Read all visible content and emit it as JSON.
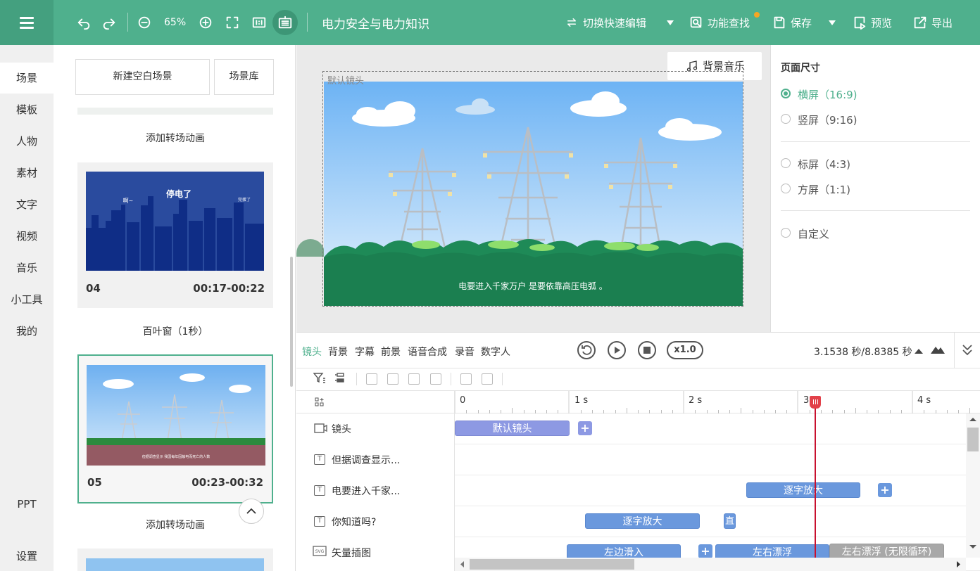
{
  "toolbar": {
    "zoom": "65%",
    "doc_title": "电力安全与电力知识",
    "switch_edit": "切换快速编辑",
    "find": "功能查找",
    "save": "保存",
    "preview": "预览",
    "export": "导出",
    "icons": [
      "menu-icon",
      "undo-icon",
      "redo-icon",
      "zoom-out-icon",
      "zoom-in-icon",
      "fullscreen-icon",
      "ratio-1-1-icon",
      "keyboard-icon",
      "swap-icon",
      "search-icon",
      "save-icon",
      "preview-icon",
      "export-icon"
    ]
  },
  "nav": {
    "items": [
      "场景",
      "模板",
      "人物",
      "素材",
      "文字",
      "视频",
      "音乐",
      "小工具",
      "我的"
    ],
    "ppt": "PPT",
    "settings": "设置"
  },
  "scenes": {
    "new_blank": "新建空白场景",
    "library": "场景库",
    "add_transition_1": "添加转场动画",
    "transition_label": "百叶窗（1秒）",
    "add_transition_2": "添加转场动画",
    "cards": [
      {
        "num": "04",
        "time": "00:17-00:22",
        "thumb_texts": [
          "停电了",
          "啊~",
          "完蛋了"
        ]
      },
      {
        "num": "05",
        "time": "00:23-00:32",
        "thumb_texts": [
          "但据调查显示 我国每年因触电而死亡的人数"
        ]
      }
    ]
  },
  "canvas": {
    "camera_label": "默认镜头",
    "bgm_button": "背景音乐",
    "subtitle": "电要进入千家万户 是要依靠高压电弧 。"
  },
  "page_size": {
    "title": "页面尺寸",
    "options": [
      "横屏（16:9)",
      "竖屏（9:16)",
      "标屏（4:3)",
      "方屏（1:1)",
      "自定义"
    ],
    "selected": "横屏（16:9)"
  },
  "timeline": {
    "tabs": [
      "镜头",
      "背景",
      "字幕",
      "前景",
      "语音合成",
      "录音",
      "数字人"
    ],
    "active_tab": "镜头",
    "speed": "x1.0",
    "time_readout": "3.1538 秒/8.8385 秒",
    "ruler": [
      "0",
      "1 s",
      "2 s",
      "3",
      "4 s"
    ],
    "playhead_seconds": 3.1538,
    "tracks": [
      {
        "name": "镜头",
        "icon": "camera-icon",
        "clips": [
          "默认镜头"
        ]
      },
      {
        "name": "但据调查显示...",
        "icon": "text-icon",
        "clips": []
      },
      {
        "name": "电要进入千家...",
        "icon": "text-icon",
        "clips": [
          "逐字放大"
        ]
      },
      {
        "name": "你知道吗?",
        "icon": "text-icon",
        "clips": [
          "逐字放大",
          "直"
        ]
      },
      {
        "name": "矢量插图",
        "icon": "svg-icon",
        "clips": [
          "左边滑入",
          "左右漂浮",
          "左右漂浮 (无限循环)"
        ]
      }
    ]
  },
  "colors": {
    "brand": "#4fb08d",
    "clip_blue": "#6a98dd",
    "clip_purple": "#8d99e3",
    "playhead": "#c8102e"
  }
}
